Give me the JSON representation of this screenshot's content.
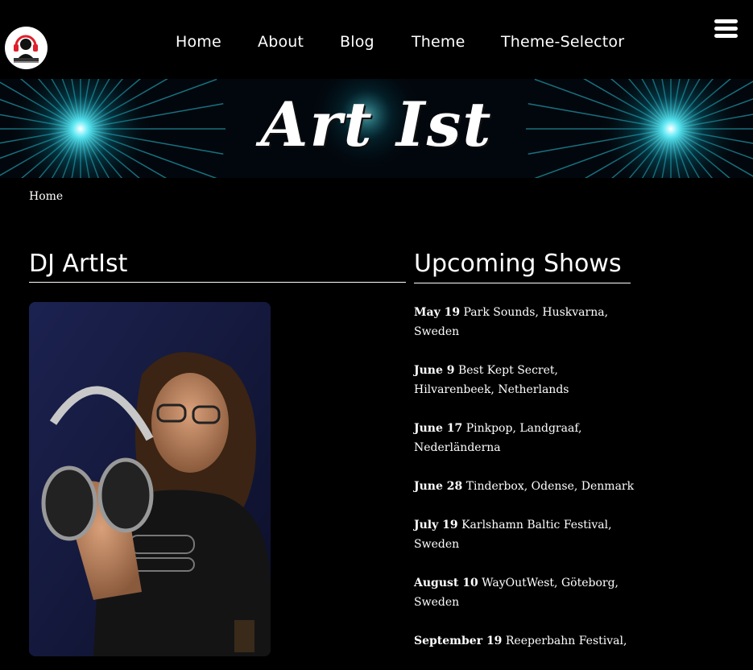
{
  "nav": {
    "items": [
      {
        "label": "Home"
      },
      {
        "label": "About"
      },
      {
        "label": "Blog"
      },
      {
        "label": "Theme"
      },
      {
        "label": "Theme-Selector"
      }
    ]
  },
  "banner": {
    "title": "Art Ist"
  },
  "breadcrumb": {
    "home": "Home"
  },
  "main": {
    "title": "DJ ArtIst",
    "photo_icon": "dj-with-headphones-photo"
  },
  "shows": {
    "title": "Upcoming Shows",
    "items": [
      {
        "date": "May 19",
        "text": " Park Sounds, Huskvarna, Sweden"
      },
      {
        "date": "June 9",
        "text": " Best Kept Secret, Hilvarenbeek, Netherlands"
      },
      {
        "date": "June 17",
        "text": " Pinkpop, Landgraaf, Nederländerna"
      },
      {
        "date": "June 28",
        "text": " Tinderbox, Odense, Denmark"
      },
      {
        "date": "July 19",
        "text": " Karlshamn Baltic Festival, Sweden"
      },
      {
        "date": "August 10",
        "text": " WayOutWest, Göteborg, Sweden"
      },
      {
        "date": "September 19",
        "text": " Reeperbahn Festival,"
      }
    ]
  },
  "icons": {
    "logo": "dj-logo-icon",
    "menu": "hamburger-menu-icon"
  },
  "colors": {
    "background": "#000000",
    "text": "#ffffff",
    "banner_glow": "#28d8e8"
  }
}
